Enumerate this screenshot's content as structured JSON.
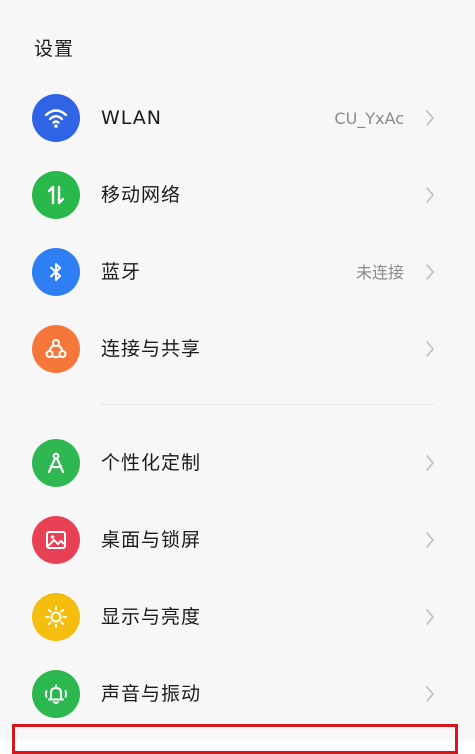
{
  "header": {
    "title": "设置"
  },
  "colors": {
    "wlan": "#2f64e6",
    "mobile": "#29b84a",
    "bluetooth": "#2d7ff3",
    "share": "#f5783a",
    "personalize": "#2fb852",
    "wallpaper": "#e84055",
    "display": "#f5bd0d",
    "sound": "#2cb74f",
    "highlight": "#d4171c"
  },
  "items": [
    {
      "label": "WLAN",
      "value": "CU_YxAc",
      "icon": "wifi-icon"
    },
    {
      "label": "移动网络",
      "value": "",
      "icon": "mobile-data-icon"
    },
    {
      "label": "蓝牙",
      "value": "未连接",
      "icon": "bluetooth-icon"
    },
    {
      "label": "连接与共享",
      "value": "",
      "icon": "share-icon"
    },
    {
      "label": "个性化定制",
      "value": "",
      "icon": "compass-icon"
    },
    {
      "label": "桌面与锁屏",
      "value": "",
      "icon": "image-icon"
    },
    {
      "label": "显示与亮度",
      "value": "",
      "icon": "sun-icon"
    },
    {
      "label": "声音与振动",
      "value": "",
      "icon": "bell-vibrate-icon"
    }
  ]
}
